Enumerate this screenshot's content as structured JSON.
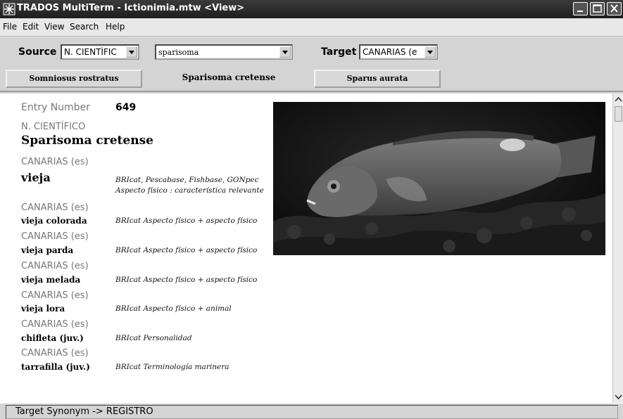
{
  "window": {
    "title": "TRADOS MultiTerm - Ictionimia.mtw <View>"
  },
  "menu": [
    "File",
    "Edit",
    "View",
    "Search",
    "Help"
  ],
  "toolbar": {
    "source_label": "Source",
    "source_value": "N. CIENTÍFIC",
    "search_value": "sparisoma",
    "target_label": "Target",
    "target_value": "CANARIAS (e",
    "prev_entry": "Somniosus rostratus",
    "current_entry": "Sparisoma cretense",
    "next_entry": "Sparus aurata"
  },
  "entry": {
    "number_label": "Entry Number",
    "number": "649",
    "source_lang": "N. CIENTÍFICO",
    "main_term": "Sparisoma cretense",
    "synonyms": [
      {
        "lang": "CANARIAS (es)",
        "term": "vieja",
        "note": "BRIcat, Pescabase, Fishbase, GONpec",
        "note2": "Aspecto físico : característica relevante"
      },
      {
        "lang": "CANARIAS (es)",
        "term": "vieja colorada",
        "note": "BRIcat  Aspecto físico + aspecto físico"
      },
      {
        "lang": "CANARIAS (es)",
        "term": "vieja parda",
        "note": "BRIcat  Aspecto físico + aspecto físico"
      },
      {
        "lang": "CANARIAS (es)",
        "term": "vieja melada",
        "note": "BRIcat  Aspecto físico + aspecto físico"
      },
      {
        "lang": "CANARIAS (es)",
        "term": "vieja lora",
        "note": "BRIcat  Aspecto físico + animal"
      },
      {
        "lang": "CANARIAS (es)",
        "term": "chifleta (juv.)",
        "note": "BRIcat  Personalidad"
      },
      {
        "lang": "CANARIAS (es)",
        "term": "tarrafilla (juv.)",
        "note": "BRIcat  Terminología marinera"
      }
    ]
  },
  "status": {
    "text": "Target Synonym -> REGISTRO"
  },
  "icons": {
    "app": "multiterm-app-icon",
    "minimize": "minimize-icon",
    "maximize": "maximize-icon",
    "close": "close-icon"
  },
  "colors": {
    "titlebar": "#2a2a2a",
    "label_grey": "#777777",
    "content_bg": "#ffffff"
  }
}
